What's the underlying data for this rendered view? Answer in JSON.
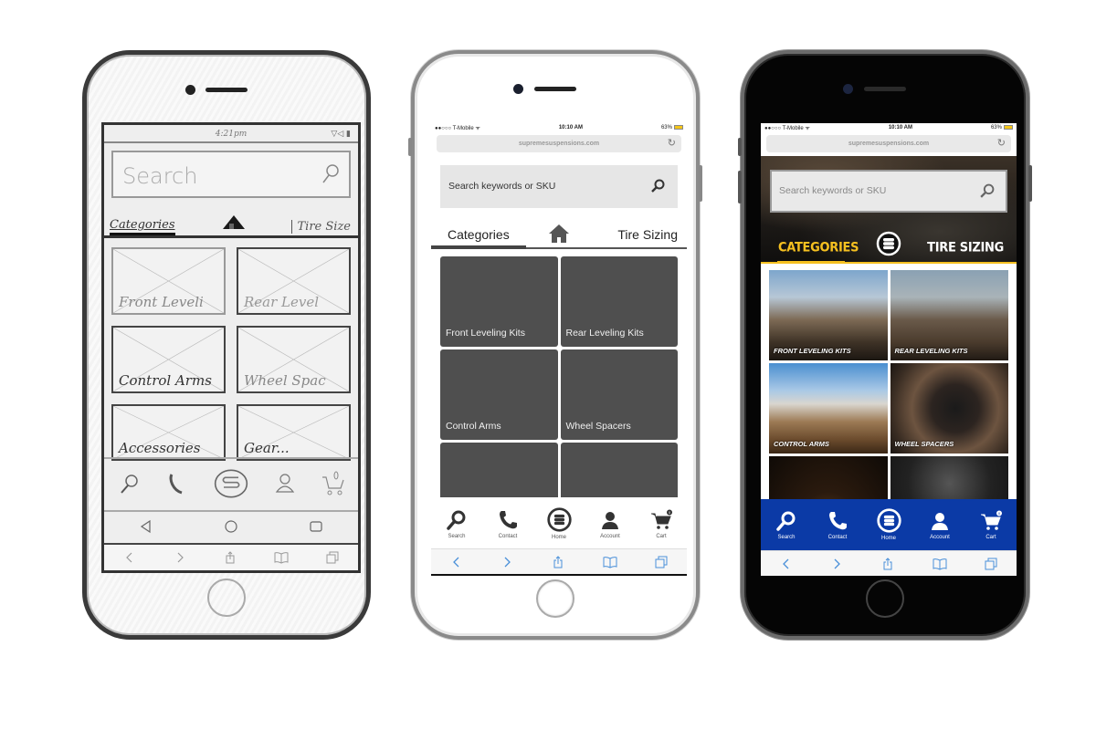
{
  "sketch": {
    "status_time": "4:21pm",
    "status_icons": "▽◁ ▮",
    "search_placeholder": "Search",
    "tabs": {
      "left": "Categories",
      "right": "Tire Size"
    },
    "tiles": [
      {
        "label": "Front Leveli"
      },
      {
        "label": "Rear Level"
      },
      {
        "label": "Control Arms"
      },
      {
        "label": "Wheel Spac"
      },
      {
        "label": "Accessories"
      },
      {
        "label": "Gear..."
      }
    ],
    "nav_icons": [
      "search-icon",
      "phone-icon",
      "logo-icon",
      "user-icon",
      "cart-icon"
    ],
    "android_icons": [
      "back-icon",
      "home-circle-icon",
      "recents-icon"
    ]
  },
  "white_phone": {
    "status": {
      "carrier": "●●○○○ T-Mobile ᯤ",
      "time": "10:10 AM",
      "battery": "63%"
    },
    "url": "supremesuspensions.com",
    "search_placeholder": "Search keywords or SKU",
    "tabs": {
      "left": "Categories",
      "right": "Tire Sizing"
    },
    "tiles": [
      {
        "label": "Front Leveling Kits"
      },
      {
        "label": "Rear Leveling Kits"
      },
      {
        "label": "Control Arms"
      },
      {
        "label": "Wheel Spacers"
      },
      {
        "label": ""
      },
      {
        "label": ""
      }
    ],
    "nav": [
      {
        "label": "Search",
        "icon": "search-icon"
      },
      {
        "label": "Contact",
        "icon": "phone-icon"
      },
      {
        "label": "Home",
        "icon": "logo-icon"
      },
      {
        "label": "Account",
        "icon": "user-icon"
      },
      {
        "label": "Cart",
        "icon": "cart-icon",
        "badge": "0"
      }
    ]
  },
  "dark_phone": {
    "status": {
      "carrier": "●●○○○ T-Mobile ᯤ",
      "time": "10:10 AM",
      "battery": "63%"
    },
    "url": "supremesuspensions.com",
    "search_placeholder": "Search keywords or SKU",
    "tabs": {
      "left": "CATEGORIES",
      "right": "TIRE SIZING"
    },
    "tiles": [
      {
        "label": "FRONT LEVELING KITS"
      },
      {
        "label": "REAR LEVELING KITS"
      },
      {
        "label": "CONTROL ARMS"
      },
      {
        "label": "WHEEL SPACERS"
      },
      {
        "label": ""
      },
      {
        "label": ""
      }
    ],
    "nav": [
      {
        "label": "Search",
        "icon": "search-icon"
      },
      {
        "label": "Contact",
        "icon": "phone-icon"
      },
      {
        "label": "Home",
        "icon": "logo-icon"
      },
      {
        "label": "Account",
        "icon": "user-icon"
      },
      {
        "label": "Cart",
        "icon": "cart-icon",
        "badge": "0"
      }
    ]
  },
  "colors": {
    "accent_yellow": "#f5c020",
    "nav_blue": "#0b3aa6",
    "tile_gray": "#4f4f4f",
    "safari_blue": "#4a90d9"
  }
}
